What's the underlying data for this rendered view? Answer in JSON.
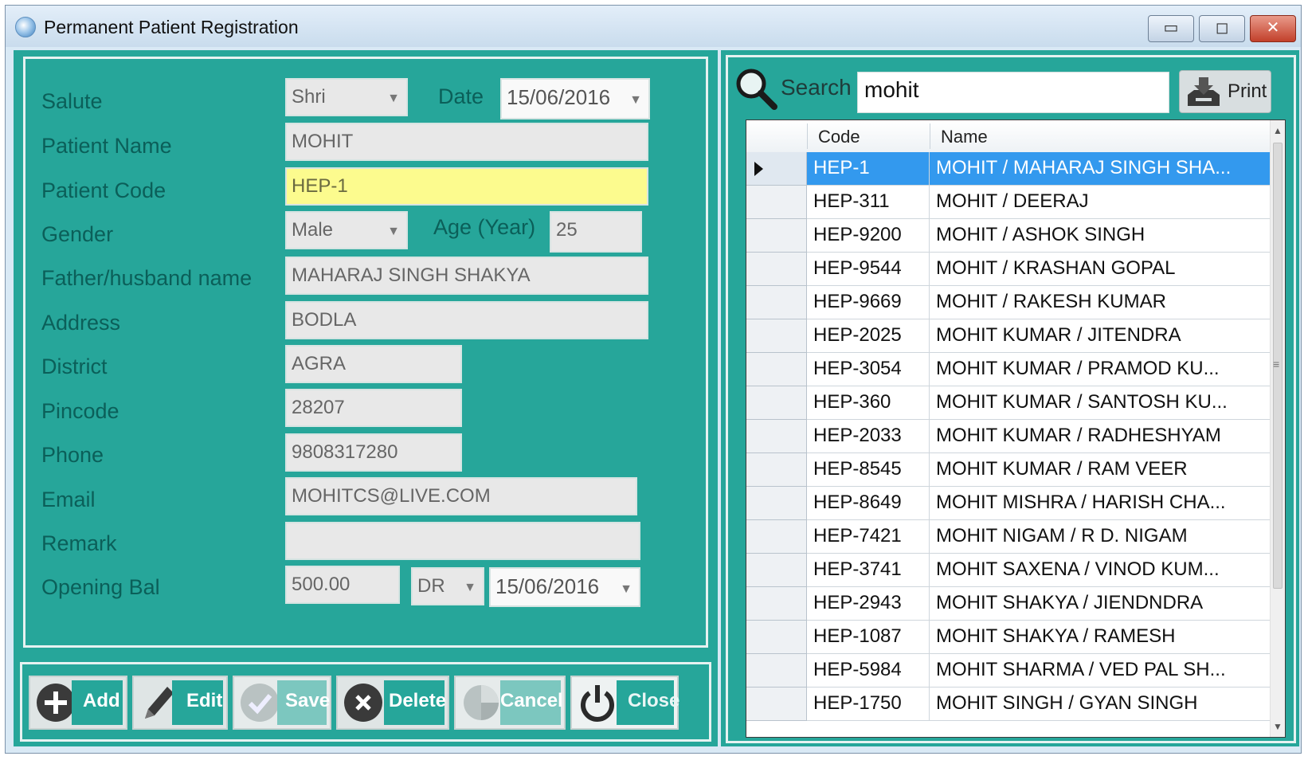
{
  "window": {
    "title": "Permanent Patient Registration",
    "controls": {
      "minimize": "▭",
      "maximize": "◻",
      "close": "✕"
    }
  },
  "form": {
    "salute": {
      "label": "Salute",
      "value": "Shri"
    },
    "date": {
      "label": "Date",
      "value": "15/06/2016"
    },
    "patient_name": {
      "label": "Patient Name",
      "value": "MOHIT"
    },
    "patient_code": {
      "label": "Patient Code",
      "value": "HEP-1"
    },
    "gender": {
      "label": "Gender",
      "value": "Male"
    },
    "age": {
      "label": "Age (Year)",
      "value": "25"
    },
    "father_husband_name": {
      "label": "Father/husband name",
      "value": "MAHARAJ SINGH SHAKYA"
    },
    "address": {
      "label": "Address",
      "value": "BODLA"
    },
    "district": {
      "label": "District",
      "value": "AGRA"
    },
    "pincode": {
      "label": "Pincode",
      "value": "28207"
    },
    "phone": {
      "label": "Phone",
      "value": "9808317280"
    },
    "email": {
      "label": "Email",
      "value": "MOHITCS@LIVE.COM"
    },
    "remark": {
      "label": "Remark",
      "value": ""
    },
    "opening_bal": {
      "label": "Opening Bal",
      "amount": "500.00",
      "type": "DR",
      "date": "15/06/2016"
    }
  },
  "buttons": {
    "add": "Add",
    "edit": "Edit",
    "save": "Save",
    "delete": "Delete",
    "cancel": "Cancel",
    "close": "Close"
  },
  "search": {
    "label": "Search",
    "value": "mohit",
    "print_label": "Print"
  },
  "grid": {
    "columns": [
      "Code",
      "Name"
    ],
    "rows": [
      {
        "code": "HEP-1",
        "name": "MOHIT / MAHARAJ SINGH SHA...",
        "selected": true
      },
      {
        "code": "HEP-311",
        "name": "MOHIT / DEERAJ"
      },
      {
        "code": "HEP-9200",
        "name": "MOHIT  / ASHOK  SINGH"
      },
      {
        "code": "HEP-9544",
        "name": "MOHIT  / KRASHAN GOPAL"
      },
      {
        "code": "HEP-9669",
        "name": "MOHIT  / RAKESH KUMAR"
      },
      {
        "code": "HEP-2025",
        "name": "MOHIT  KUMAR  / JITENDRA"
      },
      {
        "code": "HEP-3054",
        "name": "MOHIT KUMAR  / PRAMOD KU..."
      },
      {
        "code": "HEP-360",
        "name": "MOHIT KUMAR / SANTOSH KU..."
      },
      {
        "code": "HEP-2033",
        "name": "MOHIT KUMAR  / RADHESHYAM"
      },
      {
        "code": "HEP-8545",
        "name": "MOHIT KUMAR / RAM VEER"
      },
      {
        "code": "HEP-8649",
        "name": "MOHIT MISHRA / HARISH CHA..."
      },
      {
        "code": "HEP-7421",
        "name": "MOHIT NIGAM  / R D. NIGAM"
      },
      {
        "code": "HEP-3741",
        "name": "MOHIT SAXENA / VINOD KUM..."
      },
      {
        "code": "HEP-2943",
        "name": "MOHIT SHAKYA / JIENDNDRA"
      },
      {
        "code": "HEP-1087",
        "name": "MOHIT SHAKYA / RAMESH"
      },
      {
        "code": "HEP-5984",
        "name": "MOHIT SHARMA  / VED PAL SH..."
      },
      {
        "code": "HEP-1750",
        "name": "MOHIT SINGH / GYAN SINGH"
      }
    ]
  },
  "colors": {
    "panel": "#26a69a",
    "label": "#0b5f59",
    "selected_row": "#3399ee",
    "code_field": "#fcfb8e"
  }
}
